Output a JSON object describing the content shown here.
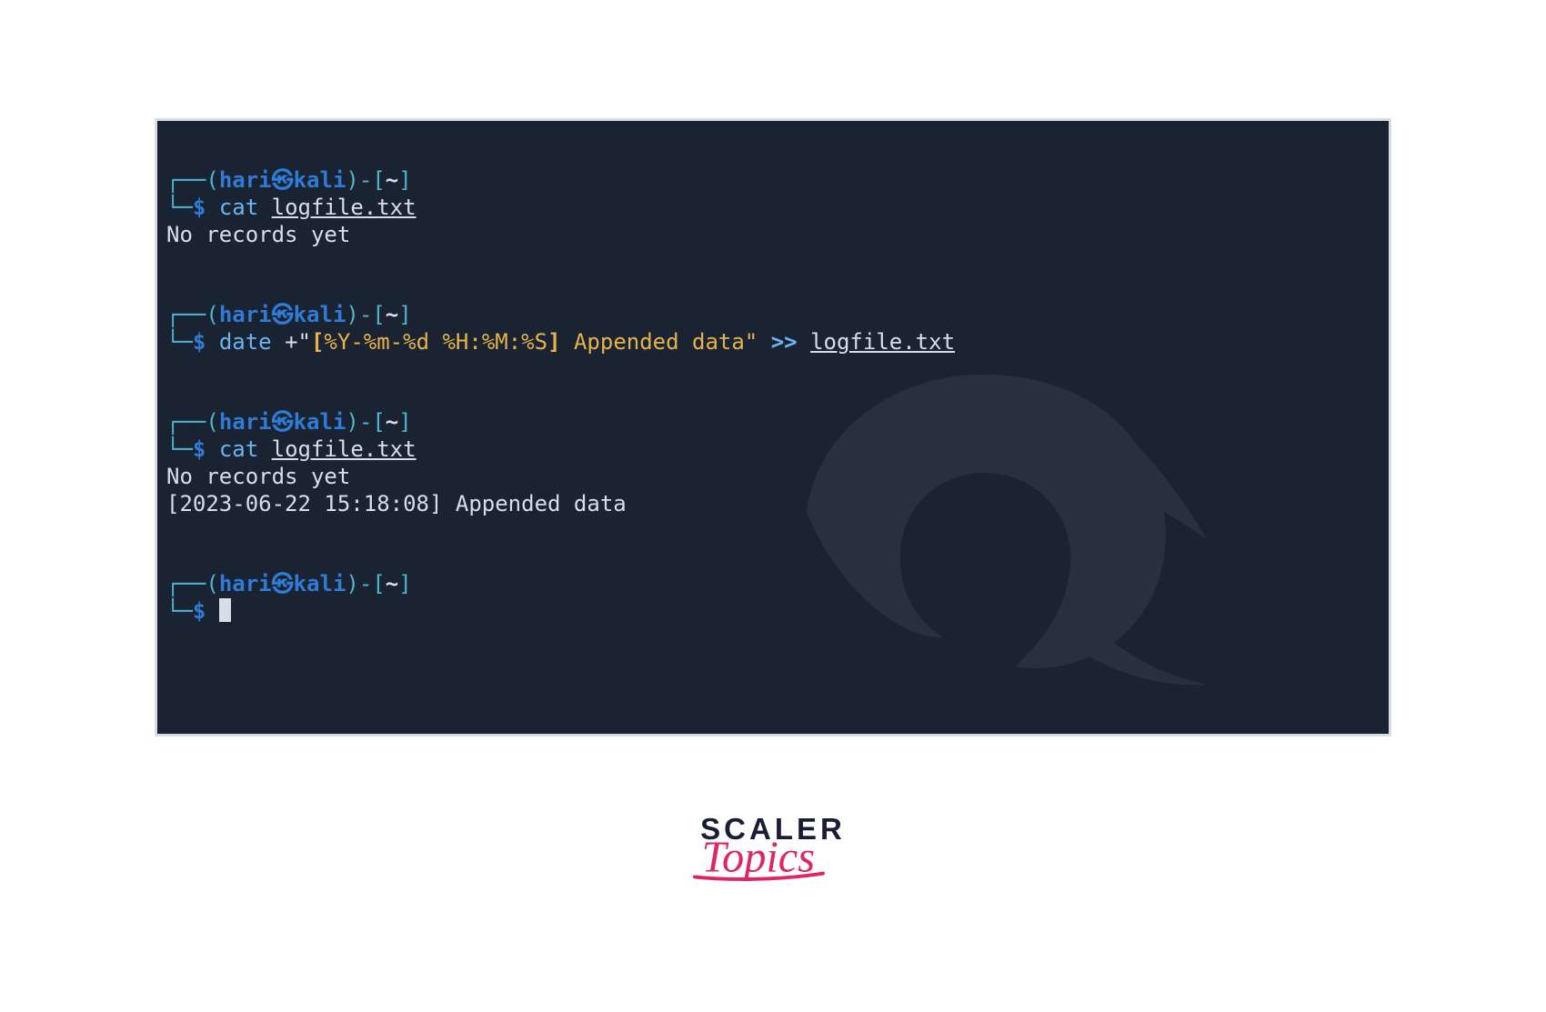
{
  "prompt": {
    "user": "hari",
    "host": "kali",
    "cwd": "~",
    "dollar": "$"
  },
  "block1": {
    "cmd": "cat",
    "file": "logfile.txt",
    "out1": "No records yet"
  },
  "block2": {
    "cmd": "date",
    "plusquote": "+\"",
    "lb": "[",
    "fmt": "%Y-%m-%d %H:%M:%S",
    "rb": "]",
    "tail": " Appended data\"",
    "redir": ">>",
    "file": "logfile.txt"
  },
  "block3": {
    "cmd": "cat",
    "file": "logfile.txt",
    "out1": "No records yet",
    "out2": "[2023-06-22 15:18:08] Appended data"
  },
  "logo": {
    "top": "SCALER",
    "bottom": "Topics"
  },
  "colors": {
    "terminal_bg": "#1a2332",
    "cyan": "#4fb4cc",
    "blue": "#2f7bd6",
    "lightblue": "#6ab4f0",
    "yellow": "#e6b34a",
    "fg": "#d8dee9",
    "logo_dark": "#1a1d34",
    "logo_pink": "#dc2666"
  }
}
